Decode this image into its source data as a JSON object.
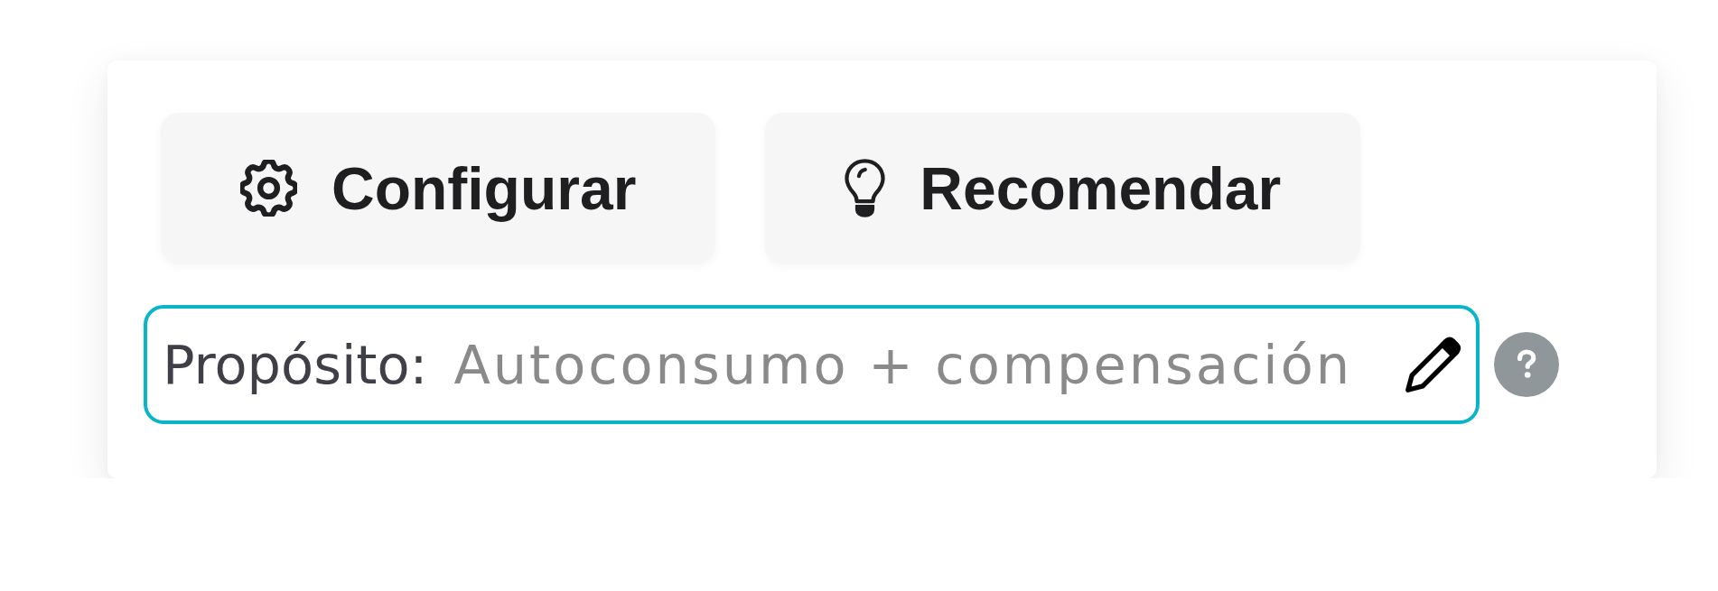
{
  "actions": [
    {
      "kind": "settings",
      "label": "Configurar"
    },
    {
      "kind": "recommend",
      "label": "Recomendar"
    }
  ],
  "purpose_field": {
    "label": "Propósito:",
    "value": "Autoconsumo + compensación",
    "focused": true
  }
}
